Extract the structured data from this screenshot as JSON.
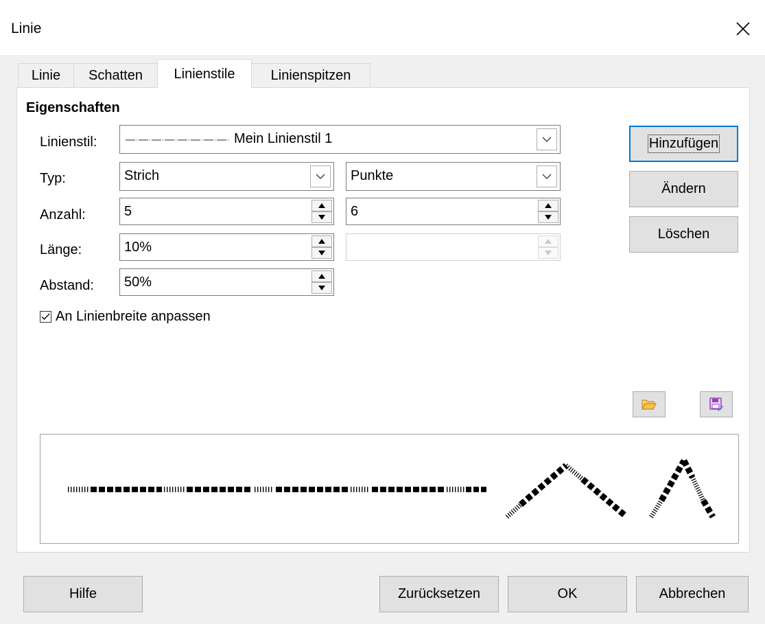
{
  "window": {
    "title": "Linie"
  },
  "tabs": [
    {
      "label": "Linie",
      "active": false
    },
    {
      "label": "Schatten",
      "active": false
    },
    {
      "label": "Linienstile",
      "active": true
    },
    {
      "label": "Linienspitzen",
      "active": false
    }
  ],
  "section": {
    "heading": "Eigenschaften"
  },
  "form": {
    "linienstil_label": "Linienstil:",
    "linienstil_value": "Mein Linienstil 1",
    "typ_label": "Typ:",
    "typ1_value": "Strich",
    "typ2_value": "Punkte",
    "anzahl_label": "Anzahl:",
    "anzahl1_value": "5",
    "anzahl2_value": "6",
    "laenge_label": "Länge:",
    "laenge1_value": "10%",
    "laenge2_value": "",
    "abstand_label": "Abstand:",
    "abstand_value": "50%",
    "fit_checkbox_label": "An Linienbreite anpassen",
    "fit_checkbox_checked": true
  },
  "side_buttons": {
    "add": "Hinzufügen",
    "modify": "Ändern",
    "delete": "Löschen"
  },
  "icons": {
    "close": "close-icon",
    "open": "folder-open-icon",
    "save": "save-icon",
    "dropdown": "chevron-down-icon",
    "spin_up": "spin-up-icon",
    "spin_down": "spin-down-icon"
  },
  "footer": {
    "help": "Hilfe",
    "reset": "Zurücksetzen",
    "ok": "OK",
    "cancel": "Abbrechen"
  },
  "colors": {
    "dialog_bg": "#f0f0f0",
    "panel_bg": "#ffffff",
    "button_bg": "#e1e1e1",
    "focus_border": "#0078d7",
    "folder_icon": "#f0a030",
    "save_icon": "#a040c0"
  }
}
